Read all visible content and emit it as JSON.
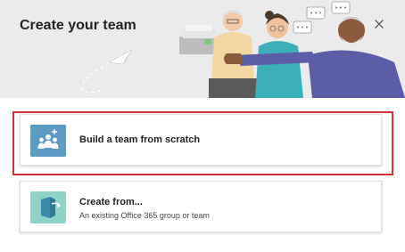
{
  "dialog": {
    "title": "Create your team",
    "close_icon": "close-icon"
  },
  "options": [
    {
      "id": "build",
      "title": "Build a team from scratch",
      "subtitle": "",
      "icon": "team-add-icon",
      "highlighted": true
    },
    {
      "id": "create-from",
      "title": "Create from...",
      "subtitle": "An existing Office 365 group or team",
      "icon": "create-from-icon",
      "highlighted": false
    }
  ],
  "colors": {
    "header_bg": "#ebebeb",
    "build_icon_bg": "#5b9bc4",
    "create_icon_bg": "#8fd2c7",
    "highlight_border": "#d13438"
  }
}
